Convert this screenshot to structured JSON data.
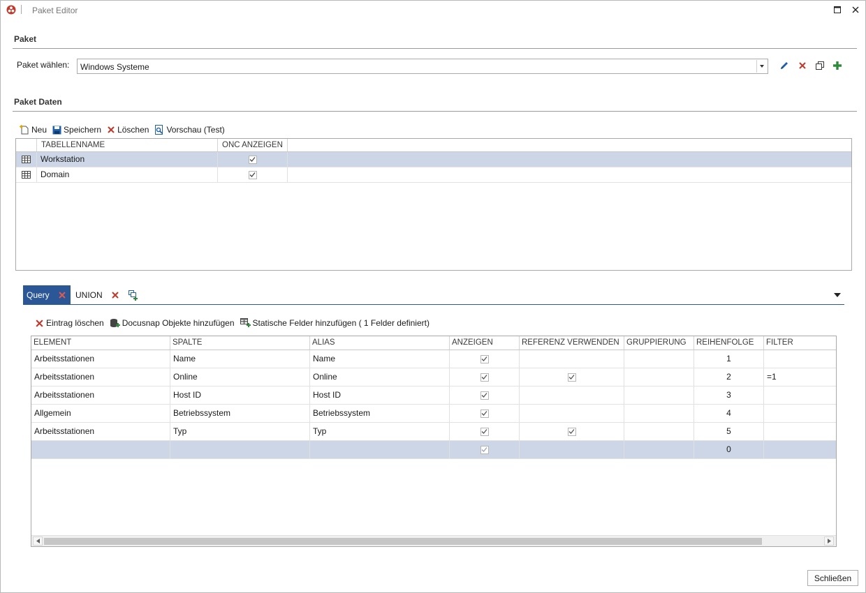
{
  "window": {
    "title": "Paket Editor"
  },
  "paket": {
    "section_title": "Paket",
    "select_label": "Paket wählen:",
    "selected_value": "Windows Systeme"
  },
  "paket_daten": {
    "section_title": "Paket Daten",
    "toolbar": {
      "new_label": "Neu",
      "save_label": "Speichern",
      "delete_label": "Löschen",
      "preview_label": "Vorschau (Test)"
    },
    "columns": [
      "TABELLENNAME",
      "ONC ANZEIGEN"
    ],
    "rows": [
      {
        "name": "Workstation",
        "onc": true
      },
      {
        "name": "Domain",
        "onc": true
      }
    ]
  },
  "tabs": {
    "query_label": "Query",
    "union_label": "UNION"
  },
  "query": {
    "toolbar": {
      "delete_entry_label": "Eintrag löschen",
      "add_objects_label": "Docusnap Objekte hinzufügen",
      "add_static_label": "Statische Felder hinzufügen ( 1 Felder definiert)"
    },
    "columns": [
      "ELEMENT",
      "SPALTE",
      "ALIAS",
      "ANZEIGEN",
      "REFERENZ VERWENDEN",
      "GRUPPIERUNG",
      "REIHENFOLGE",
      "FILTER"
    ],
    "rows": [
      {
        "element": "Arbeitsstationen",
        "spalte": "Name",
        "alias": "Name",
        "anzeigen": true,
        "referenz": false,
        "gruppierung": "",
        "reihenfolge": "1",
        "filter": ""
      },
      {
        "element": "Arbeitsstationen",
        "spalte": "Online",
        "alias": "Online",
        "anzeigen": true,
        "referenz": true,
        "gruppierung": "",
        "reihenfolge": "2",
        "filter": "=1"
      },
      {
        "element": "Arbeitsstationen",
        "spalte": "Host ID",
        "alias": "Host ID",
        "anzeigen": true,
        "referenz": false,
        "gruppierung": "",
        "reihenfolge": "3",
        "filter": ""
      },
      {
        "element": "Allgemein",
        "spalte": "Betriebssystem",
        "alias": "Betriebssystem",
        "anzeigen": true,
        "referenz": false,
        "gruppierung": "",
        "reihenfolge": "4",
        "filter": ""
      },
      {
        "element": "Arbeitsstationen",
        "spalte": "Typ",
        "alias": "Typ",
        "anzeigen": true,
        "referenz": true,
        "gruppierung": "",
        "reihenfolge": "5",
        "filter": ""
      },
      {
        "element": "",
        "spalte": "",
        "alias": "",
        "anzeigen": true,
        "referenz": false,
        "gruppierung": "",
        "reihenfolge": "0",
        "filter": ""
      }
    ]
  },
  "footer": {
    "close_label": "Schließen"
  },
  "colors": {
    "accent": "#2b5797",
    "selection": "#ccd6e6",
    "delete_red": "#c0392b",
    "add_green": "#2e8b3a"
  }
}
